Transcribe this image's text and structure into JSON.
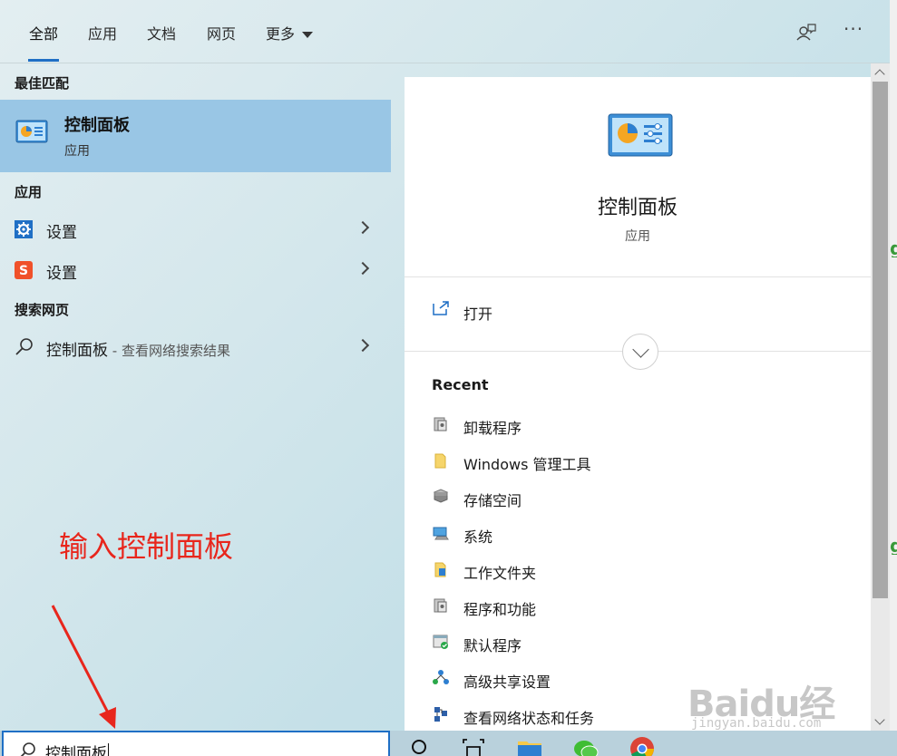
{
  "tabs": [
    {
      "label": "全部",
      "active": true
    },
    {
      "label": "应用"
    },
    {
      "label": "文档"
    },
    {
      "label": "网页"
    },
    {
      "label": "更多"
    }
  ],
  "top_actions": {
    "feedback_icon": "feedback-icon",
    "more_label": "···"
  },
  "left": {
    "best_match_heading": "最佳匹配",
    "best_match": {
      "title": "控制面板",
      "subtitle": "应用",
      "icon": "control-panel-icon"
    },
    "apps_heading": "应用",
    "apps": [
      {
        "label": "设置",
        "icon": "settings-gear-icon"
      },
      {
        "label": "设置",
        "icon": "sogou-icon"
      }
    ],
    "web_heading": "搜索网页",
    "web_result": {
      "label": "控制面板",
      "hint": " - 查看网络搜索结果",
      "icon": "search-icon"
    }
  },
  "annotation": "输入控制面板",
  "detail": {
    "title": "控制面板",
    "subtitle": "应用",
    "open_label": "打开",
    "recent_heading": "Recent",
    "recent": [
      {
        "label": "卸载程序",
        "icon": "programs-icon"
      },
      {
        "label": "Windows 管理工具",
        "icon": "folder-icon"
      },
      {
        "label": "存储空间",
        "icon": "storage-icon"
      },
      {
        "label": "系统",
        "icon": "system-icon"
      },
      {
        "label": "工作文件夹",
        "icon": "work-folders-icon"
      },
      {
        "label": "程序和功能",
        "icon": "programs-icon"
      },
      {
        "label": "默认程序",
        "icon": "default-programs-icon"
      },
      {
        "label": "高级共享设置",
        "icon": "sharing-icon"
      },
      {
        "label": "查看网络状态和任务",
        "icon": "network-icon"
      }
    ]
  },
  "search": {
    "value": "控制面板"
  },
  "watermark": {
    "text": "Baidu经验",
    "sub": "jingyan.baidu.com"
  },
  "colors": {
    "accent": "#1f6fc5",
    "selected": "#99c6e5",
    "annotation": "#e8261c"
  }
}
